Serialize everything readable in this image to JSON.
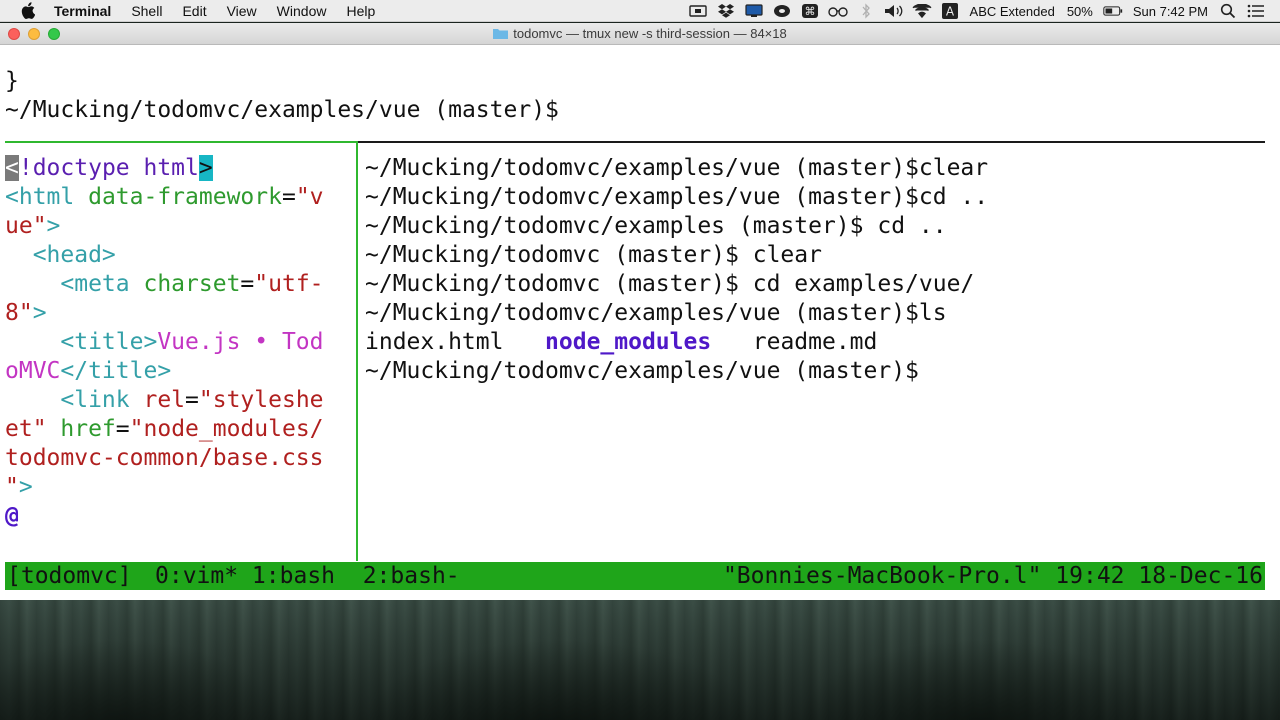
{
  "menubar": {
    "app_name": "Terminal",
    "items": [
      "Shell",
      "Edit",
      "View",
      "Window",
      "Help"
    ],
    "keyboard_layout": "ABC Extended",
    "battery": "50%",
    "clock": "Sun 7:42 PM"
  },
  "window": {
    "title": "todomvc — tmux new -s third-session — 84×18"
  },
  "top_pane": {
    "lines": [
      "}",
      "~/Mucking/todomvc/examples/vue (master)$"
    ]
  },
  "vim_pane": {
    "l1_lt": "<",
    "l1_doctype": "!doctype html",
    "l1_gt": ">",
    "l2_a": "<html ",
    "l2_b": "data-framework",
    "l2_c": "=",
    "l2_d": "\"v",
    "l3_a": "ue\"",
    "l3_b": ">",
    "l4": "  <head>",
    "l5_a": "    <meta ",
    "l5_b": "charset",
    "l5_c": "=",
    "l5_d": "\"utf-",
    "l6_a": "8\"",
    "l6_b": ">",
    "l7_a": "    <title>",
    "l7_b": "Vue.js • Tod",
    "l8_a": "oMVC",
    "l8_b": "</title>",
    "l9_a": "    <link ",
    "l9_b": "rel",
    "l9_c": "=",
    "l9_d": "\"styleshe",
    "l10_a": "et\"",
    "l10_b": " href",
    "l10_c": "=",
    "l10_d": "\"node_modules/",
    "l11": "todomvc-common/base.css",
    "l12_a": "\"",
    "l12_b": ">",
    "l13": "@"
  },
  "bash_pane": {
    "lines": [
      "~/Mucking/todomvc/examples/vue (master)$clear",
      "~/Mucking/todomvc/examples/vue (master)$cd ..",
      "~/Mucking/todomvc/examples (master)$ cd ..",
      "~/Mucking/todomvc (master)$ clear",
      "~/Mucking/todomvc (master)$ cd examples/vue/"
    ],
    "ls_cmd": "~/Mucking/todomvc/examples/vue (master)$ls",
    "ls_file1": "index.html",
    "ls_dir": "node_modules",
    "ls_file2": "readme.md",
    "prompt": "~/Mucking/todomvc/examples/vue (master)$"
  },
  "tmux_status": {
    "session": "[todomvc]",
    "windows": "0:vim* 1:bash  2:bash-",
    "right": "\"Bonnies-MacBook-Pro.l\" 19:42 18-Dec-16"
  },
  "colors": {
    "status_green": "#1fa51a",
    "pane_border_green": "#2fb82f"
  }
}
